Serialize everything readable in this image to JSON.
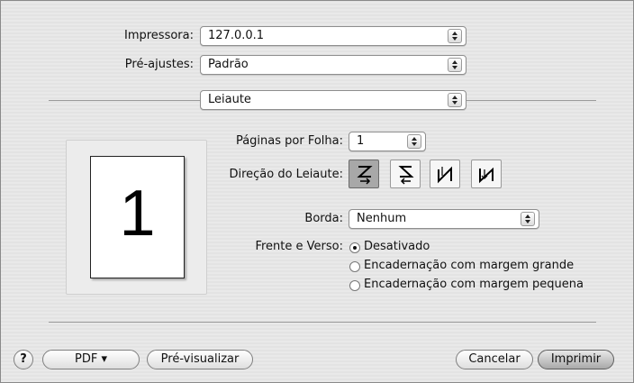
{
  "printer": {
    "label": "Impressora:",
    "value": "127.0.0.1"
  },
  "presets": {
    "label": "Pré-ajustes:",
    "value": "Padrão"
  },
  "panel": {
    "value": "Leiaute"
  },
  "preview": {
    "page_number": "1"
  },
  "layout": {
    "pages_per_sheet": {
      "label": "Páginas por Folha:",
      "value": "1"
    },
    "direction": {
      "label": "Direção do Leiaute:",
      "options": [
        "z-order",
        "s-order",
        "n-order",
        "reverse-n-order"
      ],
      "selected": 0
    },
    "border": {
      "label": "Borda:",
      "value": "Nenhum"
    },
    "two_sided": {
      "label": "Frente e Verso:",
      "options": [
        "Desativado",
        "Encadernação com margem grande",
        "Encadernação com margem pequena"
      ],
      "selected": 0
    }
  },
  "footer": {
    "help": "?",
    "pdf": "PDF ▾",
    "preview": "Pré-visualizar",
    "cancel": "Cancelar",
    "print": "Imprimir"
  }
}
